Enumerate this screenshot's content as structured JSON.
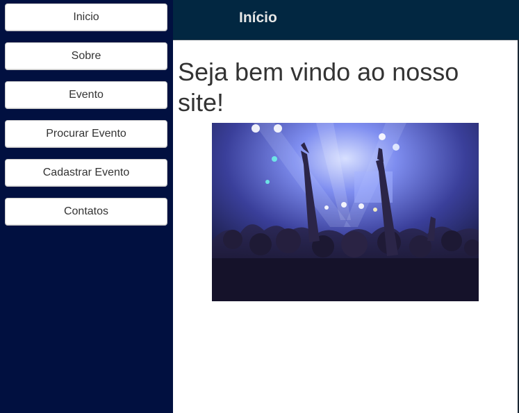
{
  "sidebar": {
    "items": [
      {
        "label": "Inicio"
      },
      {
        "label": "Sobre"
      },
      {
        "label": "Evento"
      },
      {
        "label": "Procurar Evento"
      },
      {
        "label": "Cadastrar Evento"
      },
      {
        "label": "Contatos"
      }
    ]
  },
  "header": {
    "title": "Início"
  },
  "main": {
    "welcome_text": "Seja bem vindo ao nosso site!",
    "image": {
      "description_icon": "concert-crowd-photo"
    }
  },
  "colors": {
    "sidebar_bg": "#011040",
    "header_bg": "#022741",
    "button_bg": "#ffffff",
    "text": "#333333"
  }
}
